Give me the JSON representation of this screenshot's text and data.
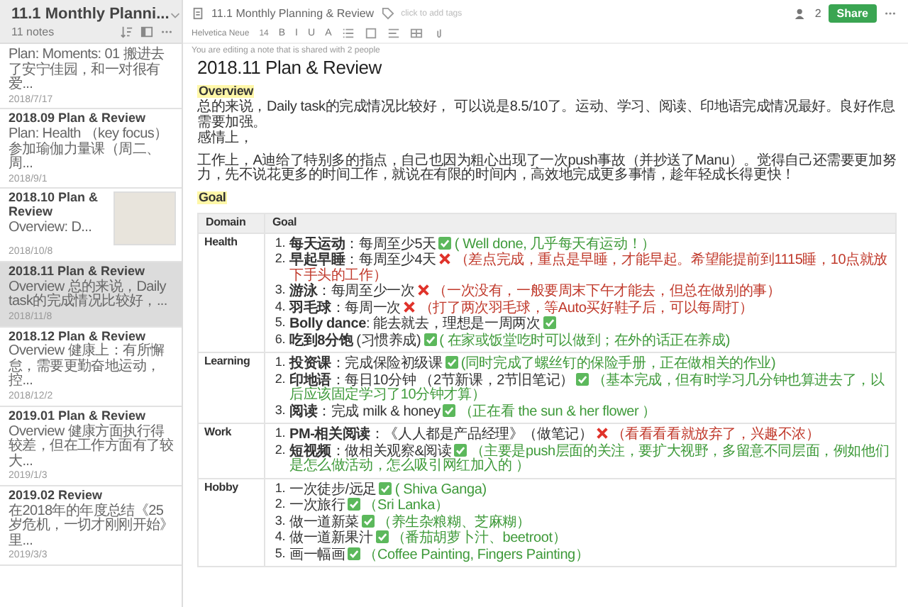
{
  "notebook": {
    "title": "11.1 Monthly Planni...",
    "count": "11 notes"
  },
  "notes": [
    {
      "preview": "Plan:  Moments: 01 搬进去了安宁佳园，和一对很有爱...",
      "date": "2018/7/17",
      "selected": false,
      "thumbnail": false
    },
    {
      "title": "2018.09 Plan & Review",
      "preview": "Plan: Health （key focus）参加瑜伽力量课（周二、周...",
      "date": "2018/9/1",
      "selected": false,
      "thumbnail": false
    },
    {
      "title": "2018.10 Plan & Review",
      "preview": "Overview: D...",
      "date": "2018/10/8",
      "selected": false,
      "thumbnail": true
    },
    {
      "title": "2018.11 Plan & Review",
      "preview": "Overview 总的来说，Daily task的完成情况比较好，...",
      "date": "2018/11/8",
      "selected": true,
      "thumbnail": false
    },
    {
      "title": "2018.12 Plan & Review",
      "preview": "Overview 健康上：有所懈怠，需要更勤奋地运动，控...",
      "date": "2018/12/2",
      "selected": false,
      "thumbnail": false
    },
    {
      "title": "2019.01 Plan & Review",
      "preview": "Overview 健康方面执行得较差，但在工作方面有了较大...",
      "date": "2019/1/3",
      "selected": false,
      "thumbnail": false
    },
    {
      "title": "2019.02 Review",
      "preview": "在2018年的年度总结《25岁危机，一切才刚刚开始》里...",
      "date": "2019/3/3",
      "selected": false,
      "thumbnail": false
    }
  ],
  "editor": {
    "note_title": "11.1 Monthly Planning & Review",
    "tags_placeholder": "click to add tags",
    "share_count": "2",
    "share_button": "Share",
    "font": "Helvetica Neue",
    "font_size": "14",
    "format_buttons": [
      "B",
      "I",
      "U",
      "A"
    ],
    "banner": "You are editing a note that is shared with 2 people"
  },
  "document": {
    "title": "2018.11 Plan & Review",
    "overview": {
      "heading": "Overview",
      "paragraphs": [
        [
          "总的来说，Daily task的完成情况比较好， 可以说是8.5/10了。运动、学习、阅读、印地语完成情况最好。良好作息需要加强。",
          "感情上，"
        ],
        [
          "工作上，A迪给了特别多的指点，自己也因为粗心出现了一次push事故（并抄送了Manu）。觉得自己还需要更加努力，先不说花更多的时间工作，就说在有限的时间内，高效地完成更多事情，趁年轻成长得更快！"
        ]
      ]
    },
    "goal": {
      "heading": "Goal",
      "columns": [
        "Domain",
        "Goal"
      ],
      "rows": [
        {
          "domain": "Health",
          "items": [
            {
              "number": "1.",
              "text": "**每天运动**：每周至少5天",
              "kind": "done",
              "comment": "( Well done, 几乎每天有运动！）"
            },
            {
              "number": "2.",
              "text": "**早起早睡**：每周至少4天",
              "kind": "failed",
              "comment": "（差点完成，重点是早睡，才能早起。希望能提前到1115睡，10点就放下手头的工作）"
            },
            {
              "number": "3.",
              "text": "**游泳**：每周至少一次",
              "kind": "failed",
              "comment": "（一次没有，一般要周末下午才能去，但总在做别的事）"
            },
            {
              "number": "4.",
              "text": "**羽毛球**：每周一次",
              "kind": "failed",
              "comment": "（打了两次羽毛球，等Auto买好鞋子后，可以每周打）"
            },
            {
              "number": "5.",
              "text": "**Bolly dance**: 能去就去，理想是一周两次",
              "kind": "done"
            },
            {
              "number": "6.",
              "text": "**吃到8分饱** (习惯养成)",
              "kind": "done",
              "comment": "( 在家或饭堂吃时可以做到；在外的话正在养成)"
            }
          ]
        },
        {
          "domain": "Learning",
          "items": [
            {
              "number": "1.",
              "text": "**投资课**：完成保险初级课",
              "kind": "done",
              "comment": "(同时完成了螺丝钉的保险手册，正在做相关的作业)"
            },
            {
              "number": "2.",
              "text": "**印地语**：每日10分钟 （2节新课，2节旧笔记）",
              "kind": "done",
              "comment": "（基本完成，但有时学习几分钟也算进去了，以后应该固定学习了10分钟才算）"
            },
            {
              "number": "3.",
              "text": "**阅读**：完成 milk & honey",
              "kind": "done",
              "comment": "（正在看 the sun & her flower ）"
            }
          ]
        },
        {
          "domain": "Work",
          "items": [
            {
              "number": "1.",
              "text": "**PM-相关阅读**：《人人都是产品经理》（做笔记）",
              "kind": "failed",
              "comment": "（看看看看就放弃了，兴趣不浓）"
            },
            {
              "number": "2.",
              "text": "**短视频**：做相关观察&阅读",
              "kind": "done",
              "comment": "（主要是push层面的关注，要扩大视野，多留意不同层面，例如他们是怎么做活动，怎么吸引网红加入的 ）"
            }
          ]
        },
        {
          "domain": "Hobby",
          "items": [
            {
              "number": "1.",
              "text": "一次徒步/远足",
              "kind": "done",
              "comment": "( Shiva Ganga)"
            },
            {
              "number": "2.",
              "text": "一次旅行",
              "kind": "done",
              "comment": "（Sri Lanka）"
            },
            {
              "number": "3.",
              "text": "做一道新菜",
              "kind": "done",
              "comment": "（养生杂粮糊、芝麻糊）"
            },
            {
              "number": "4.",
              "text": "做一道新果汁",
              "kind": "done",
              "comment": "（番茄胡萝卜汁、beetroot）"
            },
            {
              "number": "5.",
              "text": "画一幅画",
              "kind": "done",
              "comment": "（Coffee Painting, Fingers Painting）"
            }
          ]
        }
      ]
    }
  }
}
